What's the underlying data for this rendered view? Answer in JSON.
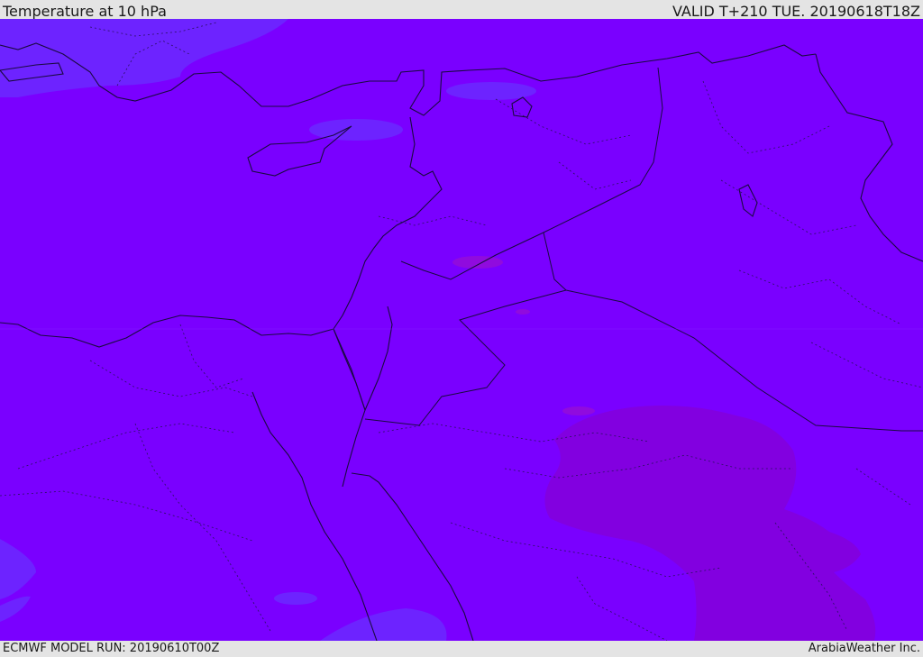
{
  "header": {
    "title": "Temperature at 10 hPa",
    "valid": "VALID T+210 TUE. 20190618T18Z"
  },
  "footer": {
    "model_run": "ECMWF MODEL RUN: 20190610T00Z",
    "credit": "ArabiaWeather Inc."
  },
  "map": {
    "base_fill_color": "#7a00ff",
    "cool_patch_color": "#6a2cff",
    "warm_patch_color": "#8200e0",
    "warm_spot_color": "#9a10d0",
    "border_color": "#1a0a40"
  }
}
